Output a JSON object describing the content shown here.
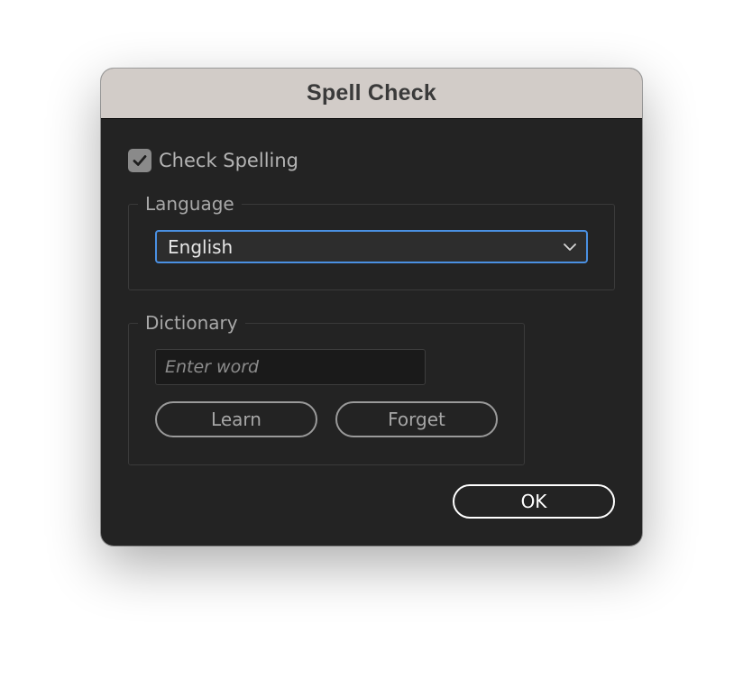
{
  "dialog": {
    "title": "Spell Check"
  },
  "check_spelling": {
    "label": "Check Spelling",
    "checked": true
  },
  "language": {
    "legend": "Language",
    "selected": "English",
    "icon": "chevron-down-icon"
  },
  "dictionary": {
    "legend": "Dictionary",
    "input_placeholder": "Enter word",
    "input_value": "",
    "learn_label": "Learn",
    "forget_label": "Forget"
  },
  "footer": {
    "ok_label": "OK"
  },
  "colors": {
    "titlebar": "#d2ccc8",
    "panel": "#232323",
    "accent": "#4a90e2"
  }
}
